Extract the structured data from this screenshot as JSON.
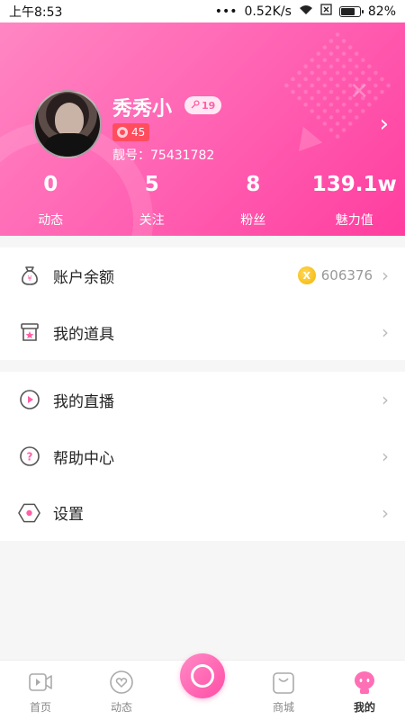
{
  "status_bar": {
    "time": "上午8:53",
    "dots": "•••",
    "network_speed": "0.52K/s",
    "battery_percent": "82%",
    "battery_level": 0.82
  },
  "profile": {
    "username": "秀秀小",
    "fans_badge_value": "19",
    "level": "45",
    "user_id": "靓号：75431782",
    "arrow": "›"
  },
  "stats": [
    {
      "value": "0",
      "label": "动态"
    },
    {
      "value": "5",
      "label": "关注"
    },
    {
      "value": "8",
      "label": "粉丝"
    },
    {
      "value": "139.1w",
      "label": "魅力值"
    }
  ],
  "group1": [
    {
      "label": "账户余额",
      "icon": "money-bag-icon",
      "value": "606376"
    },
    {
      "label": "我的道具",
      "icon": "gift-box-icon"
    }
  ],
  "group2": [
    {
      "label": "我的直播",
      "icon": "play-circle-icon"
    },
    {
      "label": "帮助中心",
      "icon": "help-circle-icon"
    },
    {
      "label": "设置",
      "icon": "hexagon-settings-icon"
    }
  ],
  "row_arrow": "›",
  "coin_glyph": "X",
  "bottom_nav": {
    "home": "首页",
    "feed": "动态",
    "mall": "商城",
    "mine": "我的"
  },
  "colors": {
    "header_gradient_start": "#ff86c3",
    "header_gradient_end": "#ff3d9f",
    "accent": "#ff5fa6",
    "level_badge": "#ff4d5e",
    "coin": "#f5b400"
  }
}
